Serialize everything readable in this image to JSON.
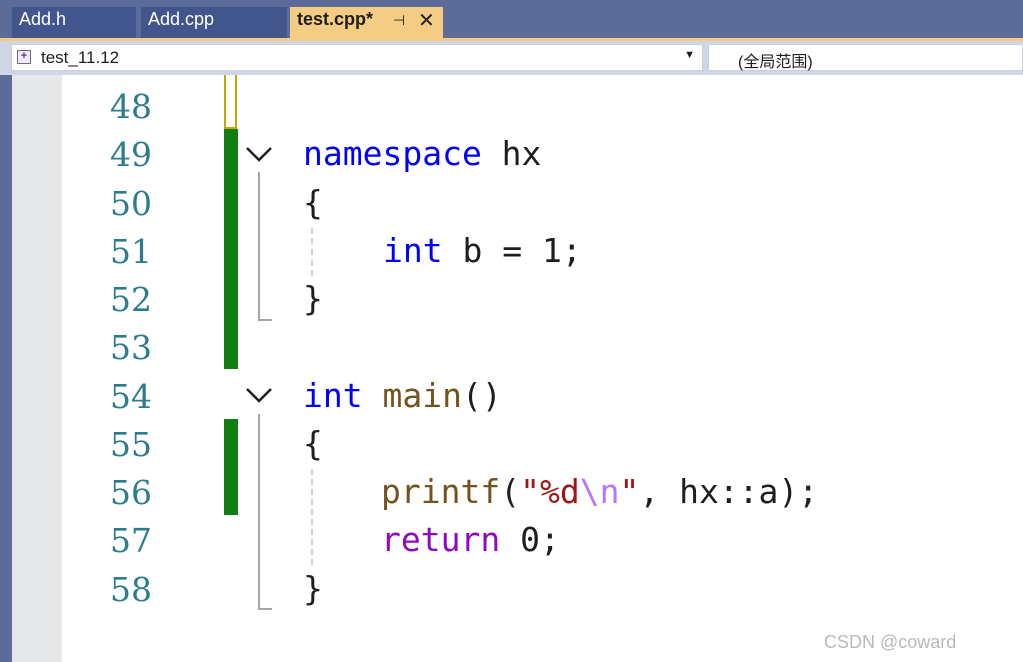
{
  "tabs": [
    {
      "label": "Add.h",
      "active": false
    },
    {
      "label": "Add.cpp",
      "active": false
    },
    {
      "label": "test.cpp*",
      "active": true
    }
  ],
  "tab_icons": {
    "pin": "pin-icon",
    "close": "close-icon"
  },
  "navbar": {
    "project": "test_11.12",
    "scope": "(全局范围)",
    "project_icon": "class-icon"
  },
  "lines": [
    {
      "number": "48"
    },
    {
      "number": "49"
    },
    {
      "number": "50"
    },
    {
      "number": "51"
    },
    {
      "number": "52"
    },
    {
      "number": "53"
    },
    {
      "number": "54"
    },
    {
      "number": "55"
    },
    {
      "number": "56"
    },
    {
      "number": "57"
    },
    {
      "number": "58"
    }
  ],
  "code": {
    "l49": {
      "kw": "namespace",
      "rest": " hx"
    },
    "l50": {
      "brace": "{"
    },
    "l51": {
      "kw": "int",
      "rest": " b = 1;"
    },
    "l52": {
      "brace": "}"
    },
    "l54": {
      "kw": "int",
      "sp": " ",
      "fn": "main",
      "rest": "()"
    },
    "l55": {
      "brace": "{"
    },
    "l56": {
      "fn": "printf",
      "p1": "(",
      "q1": "\"",
      "fmt": "%d",
      "esc": "\\n",
      "q2": "\"",
      "rest": ", hx::a);"
    },
    "l57": {
      "kw": "return",
      "rest": " 0;"
    },
    "l58": {
      "brace": "}"
    }
  },
  "colors": {
    "keyword": "#0000ff",
    "function": "#74531f",
    "control": "#8f08c4",
    "string": "#a31515",
    "escape": "#b776fb",
    "line_number": "#2b7c8f",
    "change_saved": "#117e11",
    "change_unsaved": "#c8a600",
    "active_tab": "#f5cc84"
  },
  "watermark": "CSDN @coward"
}
